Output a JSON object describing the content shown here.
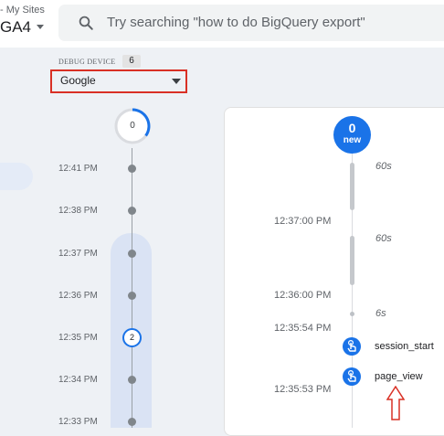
{
  "header": {
    "breadcrumb": "- My Sites",
    "property": "GA4",
    "search_placeholder": "Try searching \"how to do BigQuery export\""
  },
  "debug": {
    "label": "DEBUG DEVICE",
    "count": "6",
    "device": "Google"
  },
  "minutes": {
    "top_count": "0",
    "rows": [
      {
        "time": "12:41 PM"
      },
      {
        "time": "12:38 PM"
      },
      {
        "time": "12:37 PM"
      },
      {
        "time": "12:36 PM"
      },
      {
        "time": "12:35 PM",
        "badge": "2"
      },
      {
        "time": "12:34 PM"
      },
      {
        "time": "12:33 PM"
      }
    ]
  },
  "seconds": {
    "new_count": "0",
    "new_label": "new",
    "gaps": [
      "60s",
      "60s",
      "6s"
    ],
    "times": [
      "12:37:00 PM",
      "12:36:00 PM",
      "12:35:54 PM",
      "12:35:53 PM"
    ],
    "events": [
      {
        "name": "session_start"
      },
      {
        "name": "page_view"
      }
    ]
  },
  "colors": {
    "accent": "#1a73e8",
    "annotation": "#d93025"
  }
}
